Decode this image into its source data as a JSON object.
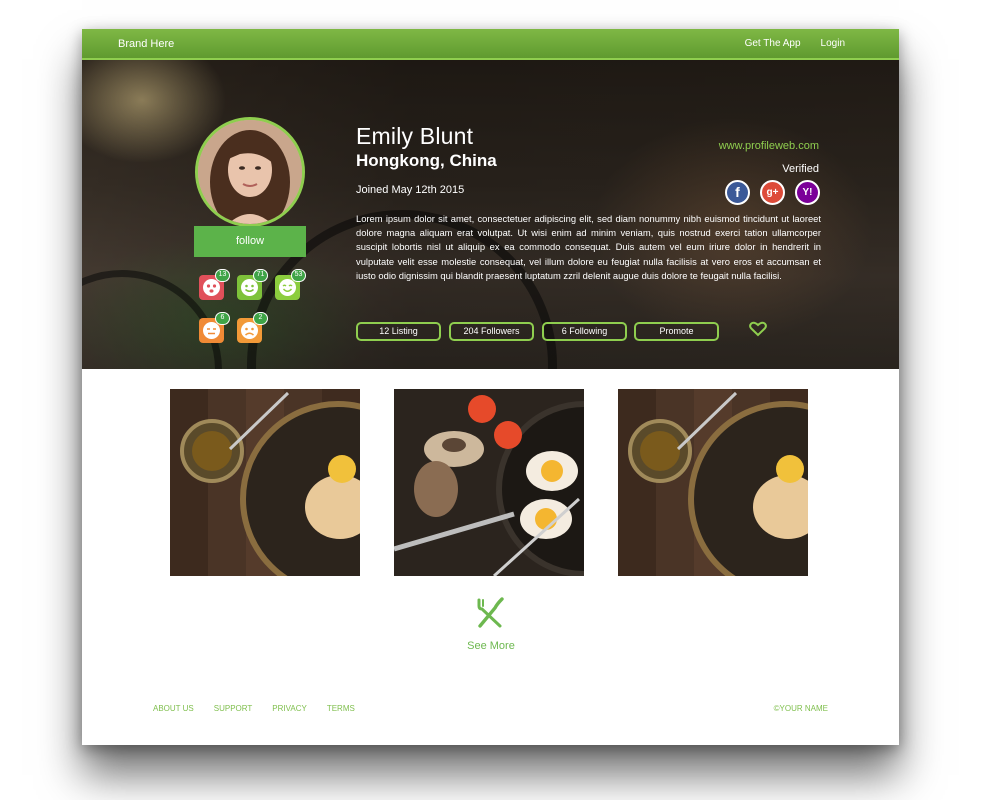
{
  "nav": {
    "brand": "Brand Here",
    "links": [
      "Get The App",
      "Login"
    ]
  },
  "profile": {
    "name": "Emily Blunt",
    "location": "Hongkong, China",
    "joined": "Joined May 12th 2015",
    "bio": "Lorem ipsum dolor sit amet, consectetuer adipiscing elit, sed diam nonummy nibh euismod tincidunt ut laoreet dolore magna aliquam erat volutpat. Ut wisi enim ad minim veniam, quis nostrud exerci tation ullamcorper suscipit lobortis nisl ut aliquip ex ea commodo consequat. Duis autem vel eum iriure dolor in hendrerit in vulputate velit esse molestie consequat, vel illum dolore eu feugiat nulla facilisis at vero eros et accumsan et iusto odio dignissim qui blandit praesent luptatum zzril delenit augue duis dolore te feugait nulla facilisi.",
    "website": "www.profileweb.com",
    "verified": "Verified",
    "follow_label": "follow",
    "social_icons": [
      "facebook-icon",
      "google-plus-icon",
      "yahoo-icon"
    ],
    "reactions": [
      {
        "icon": "love-face-icon",
        "count": "13",
        "color": "#e0505a"
      },
      {
        "icon": "smile-face-icon",
        "count": "71",
        "color": "#7ec23a"
      },
      {
        "icon": "happy-face-icon",
        "count": "53",
        "color": "#8ccd3e"
      },
      {
        "icon": "neutral-face-icon",
        "count": "6",
        "color": "#f08a35"
      },
      {
        "icon": "sad-face-icon",
        "count": "2",
        "color": "#f29a38"
      }
    ],
    "stats": [
      "12 Listing",
      "204 Followers",
      "6 Following",
      "Promote"
    ]
  },
  "gallery": {
    "see_more": "See More",
    "icon": "fork-knife-icon"
  },
  "footer": {
    "links": [
      "ABOUT US",
      "SUPPORT",
      "PRIVACY",
      "TERMS"
    ],
    "copyright": "©YOUR NAME"
  },
  "colors": {
    "accent": "#8fce4f",
    "button": "#5cb34a",
    "nav": "#6ea83a"
  }
}
